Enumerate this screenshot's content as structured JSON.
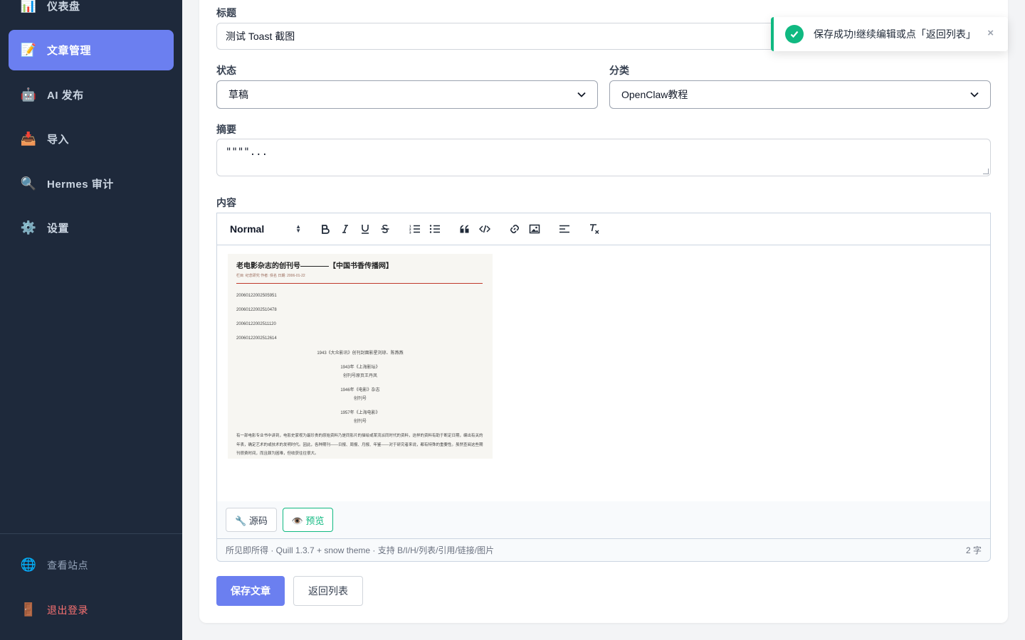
{
  "sidebar": {
    "items": [
      {
        "icon": "bar-chart-icon",
        "glyph": "📊",
        "label": "仪表盘"
      },
      {
        "icon": "memo-icon",
        "glyph": "📝",
        "label": "文章管理"
      },
      {
        "icon": "robot-icon",
        "glyph": "🤖",
        "label": "AI 发布"
      },
      {
        "icon": "inbox-icon",
        "glyph": "📥",
        "label": "导入"
      },
      {
        "icon": "magnifier-icon",
        "glyph": "🔍",
        "label": "Hermes 审计"
      },
      {
        "icon": "gear-icon",
        "glyph": "⚙️",
        "label": "设置"
      }
    ],
    "bottom": [
      {
        "icon": "globe-icon",
        "glyph": "🌐",
        "label": "查看站点"
      },
      {
        "icon": "door-icon",
        "glyph": "🚪",
        "label": "退出登录"
      }
    ],
    "active_color": "#6b7ff0"
  },
  "form": {
    "title_label": "标题",
    "title_value": "测试 Toast 截图",
    "status_label": "状态",
    "status_value": "草稿",
    "category_label": "分类",
    "category_value": "OpenClaw教程",
    "summary_label": "摘要",
    "summary_value": "\"\"\"\"...",
    "content_label": "内容"
  },
  "editor": {
    "format_select": "Normal",
    "toolbar_icons": [
      "bold-icon",
      "italic-icon",
      "underline-icon",
      "strike-icon",
      "ordered-list-icon",
      "bullet-list-icon",
      "blockquote-icon",
      "code-icon",
      "link-icon",
      "image-icon",
      "align-icon",
      "clean-icon"
    ],
    "source_button": "🔧 源码",
    "preview_button": "👁️ 预览",
    "status_text": "所见即所得 · Quill 1.3.7 + snow theme · 支持 B/I/H/列表/引用/链接/图片",
    "char_count": "2 字",
    "embedded_image": {
      "title": "老电影杂志的创刊号————【中国书香传播网】",
      "meta": "栏目: 纪念研究    作者: 佚名    日期: 2006-01-22",
      "alts": [
        "20060122002505951",
        "20060122002510478",
        "20060122002511120",
        "20060122002512614"
      ],
      "captions": [
        "1943《大众影讯》创刊封面影星刘琼、陈燕燕",
        "1943年《上海影坛》",
        "创刊号原页王丹凤",
        "1946年《电影》杂志",
        "创刊号",
        "1957年《上海电影》",
        "创刊号"
      ],
      "paragraph": "有一部电影专业书中讲到，电影史家视为最珍贵的原始资料乃是同影片的描绘或某流派同时代的资料，这样的资料有助于断定日期，编出有关的年表，确定艺术的或技术的发明时代。因此，各种期刊——日报、周报、月报、年鉴——对于研究者来说，都有特殊的重要性。虽然查阅这些期刊很费时间，而且颇为困难，但收获往往很大。"
    }
  },
  "actions": {
    "save": "保存文章",
    "back": "返回列表"
  },
  "toast": {
    "message": "保存成功!继续编辑或点「返回列表」",
    "close": "×",
    "color": "#10b981"
  }
}
